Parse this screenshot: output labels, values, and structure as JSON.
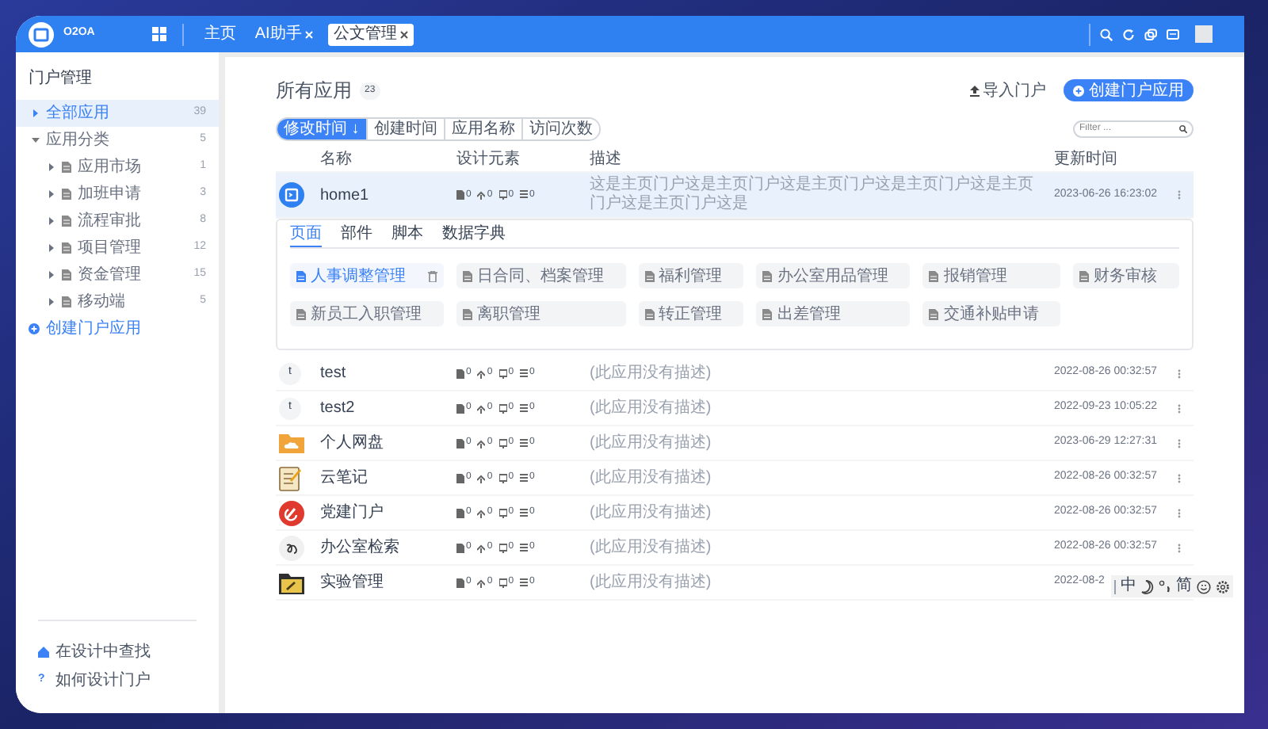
{
  "top_bar": {
    "logo_text": "O2OA",
    "tabs": [
      {
        "label": "主页",
        "closable": false,
        "selected": false
      },
      {
        "label": "AI助手",
        "closable": true,
        "selected": false
      },
      {
        "label": "公文管理",
        "closable": true,
        "selected": true
      }
    ]
  },
  "sidebar": {
    "title": "门户管理",
    "items": [
      {
        "label": "全部应用",
        "count": "39",
        "selected": true,
        "expanded": false
      },
      {
        "label": "应用分类",
        "count": "5",
        "selected": false,
        "expanded": true,
        "children": [
          {
            "label": "应用市场",
            "count": "1",
            "selected": false,
            "expanded": false
          },
          {
            "label": "加班申请",
            "count": "3",
            "selected": false,
            "expanded": false
          },
          {
            "label": "流程审批",
            "count": "8",
            "selected": false,
            "expanded": false
          },
          {
            "label": "项目管理",
            "count": "12",
            "selected": false,
            "expanded": false
          },
          {
            "label": "资金管理",
            "count": "15",
            "selected": false,
            "expanded": false
          },
          {
            "label": "移动端",
            "count": "5",
            "selected": false,
            "expanded": false
          }
        ]
      }
    ],
    "create_link": "创建门户应用",
    "footer_links": [
      {
        "kind": "home",
        "label": "在设计中查找"
      },
      {
        "kind": "help",
        "mark": "?",
        "label": "如何设计门户"
      }
    ]
  },
  "main": {
    "title": "所有应用",
    "count": "23",
    "import_button": "导入门户",
    "create_button": "创建门户应用",
    "sort_tabs": [
      {
        "label": "修改时间 ↓",
        "selected": true
      },
      {
        "label": "创建时间",
        "selected": false
      },
      {
        "label": "应用名称",
        "selected": false
      },
      {
        "label": "访问次数",
        "selected": false
      }
    ],
    "filter": {
      "placeholder": "Filter ..."
    },
    "table": {
      "columns": [
        "名称",
        "设计元素",
        "描述",
        "更新时间"
      ],
      "rows": [
        {
          "kind": "app-logo",
          "name": "home1",
          "elements": [
            "0",
            "0",
            "0",
            "0"
          ],
          "description": "这是主页门户这是主页门户这是主页门户这是主页门户这是主页门户这是主页门户这是",
          "time": "2023-06-26 16:23:02",
          "expanded": true,
          "panel": {
            "tabs": [
              {
                "label": "页面",
                "selected": true
              },
              {
                "label": "部件",
                "selected": false
              },
              {
                "label": "脚本",
                "selected": false
              },
              {
                "label": "数据字典",
                "selected": false
              }
            ],
            "tiles": [
              {
                "label": "人事调整管理",
                "selected": true
              },
              {
                "label": "日合同、档案管理",
                "selected": false
              },
              {
                "label": "福利管理",
                "selected": false
              },
              {
                "label": "办公室用品管理",
                "selected": false
              },
              {
                "label": "报销管理",
                "selected": false
              },
              {
                "label": "财务审核",
                "selected": false
              },
              {
                "label": "新员工入职管理",
                "selected": false
              },
              {
                "label": "离职管理",
                "selected": false
              },
              {
                "label": "转正管理",
                "selected": false
              },
              {
                "label": "出差管理",
                "selected": false
              },
              {
                "label": "交通补贴申请",
                "selected": false
              }
            ]
          }
        },
        {
          "kind": "letter",
          "letter": "t",
          "name": "test",
          "elements": [
            "0",
            "0",
            "0",
            "0"
          ],
          "description": "(此应用没有描述)",
          "time": "2022-08-26 00:32:57",
          "expanded": false
        },
        {
          "kind": "letter",
          "letter": "t",
          "name": "test2",
          "elements": [
            "0",
            "0",
            "0",
            "0"
          ],
          "description": "(此应用没有描述)",
          "time": "2022-09-23 10:05:22",
          "expanded": false
        },
        {
          "kind": "cloud-folder",
          "name": "个人网盘",
          "elements": [
            "0",
            "0",
            "0",
            "0"
          ],
          "description": "(此应用没有描述)",
          "time": "2023-06-29 12:27:31",
          "expanded": false
        },
        {
          "kind": "notepad",
          "name": "云笔记",
          "elements": [
            "0",
            "0",
            "0",
            "0"
          ],
          "description": "(此应用没有描述)",
          "time": "2022-08-26 00:32:57",
          "expanded": false
        },
        {
          "kind": "emblem",
          "name": "党建门户",
          "elements": [
            "0",
            "0",
            "0",
            "0"
          ],
          "description": "(此应用没有描述)",
          "time": "2022-08-26 00:32:57",
          "expanded": false
        },
        {
          "kind": "swirl",
          "name": "办公室检索",
          "elements": [
            "0",
            "0",
            "0",
            "0"
          ],
          "description": "(此应用没有描述)",
          "time": "2022-08-26 00:32:57",
          "expanded": false
        },
        {
          "kind": "tool-folder",
          "name": "实验管理",
          "elements": [
            "0",
            "0",
            "0",
            "0"
          ],
          "description": "(此应用没有描述)",
          "time": "2022-08-2",
          "expanded": false
        }
      ]
    }
  },
  "ime_bar": [
    {
      "kind": "text",
      "label": "中"
    },
    {
      "kind": "moon"
    },
    {
      "kind": "punct"
    },
    {
      "kind": "text",
      "label": "简"
    },
    {
      "kind": "emoji"
    },
    {
      "kind": "gear"
    }
  ]
}
